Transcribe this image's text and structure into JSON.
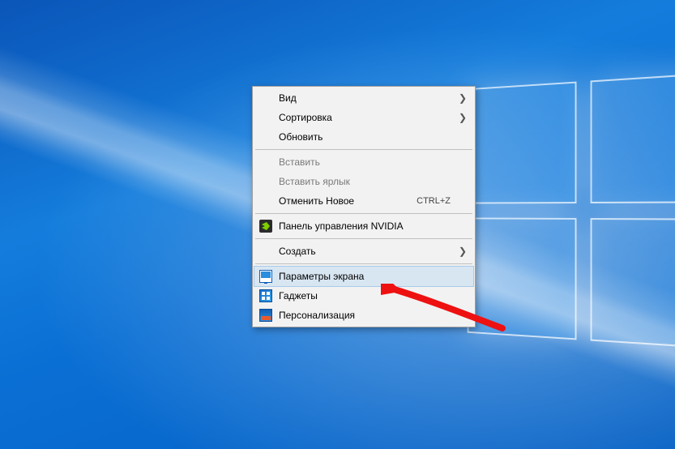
{
  "context_menu": {
    "items": [
      {
        "id": "view",
        "label": "Вид",
        "submenu": true,
        "enabled": true
      },
      {
        "id": "sort",
        "label": "Сортировка",
        "submenu": true,
        "enabled": true
      },
      {
        "id": "refresh",
        "label": "Обновить",
        "submenu": false,
        "enabled": true
      },
      {
        "id": "sep1",
        "separator": true
      },
      {
        "id": "paste",
        "label": "Вставить",
        "submenu": false,
        "enabled": false
      },
      {
        "id": "paste-shortcut",
        "label": "Вставить ярлык",
        "submenu": false,
        "enabled": false
      },
      {
        "id": "undo-new",
        "label": "Отменить Новое",
        "submenu": false,
        "enabled": true,
        "shortcut": "CTRL+Z"
      },
      {
        "id": "sep2",
        "separator": true
      },
      {
        "id": "nvidia",
        "label": "Панель управления NVIDIA",
        "submenu": false,
        "enabled": true,
        "icon": "nvidia-icon"
      },
      {
        "id": "sep3",
        "separator": true
      },
      {
        "id": "new",
        "label": "Создать",
        "submenu": true,
        "enabled": true
      },
      {
        "id": "sep4",
        "separator": true
      },
      {
        "id": "display-settings",
        "label": "Параметры экрана",
        "submenu": false,
        "enabled": true,
        "icon": "display-icon",
        "highlighted": true
      },
      {
        "id": "gadgets",
        "label": "Гаджеты",
        "submenu": false,
        "enabled": true,
        "icon": "gadgets-icon"
      },
      {
        "id": "personalize",
        "label": "Персонализация",
        "submenu": false,
        "enabled": true,
        "icon": "personalize-icon"
      }
    ]
  },
  "annotation": {
    "type": "red-arrow",
    "points_to": "display-settings"
  }
}
